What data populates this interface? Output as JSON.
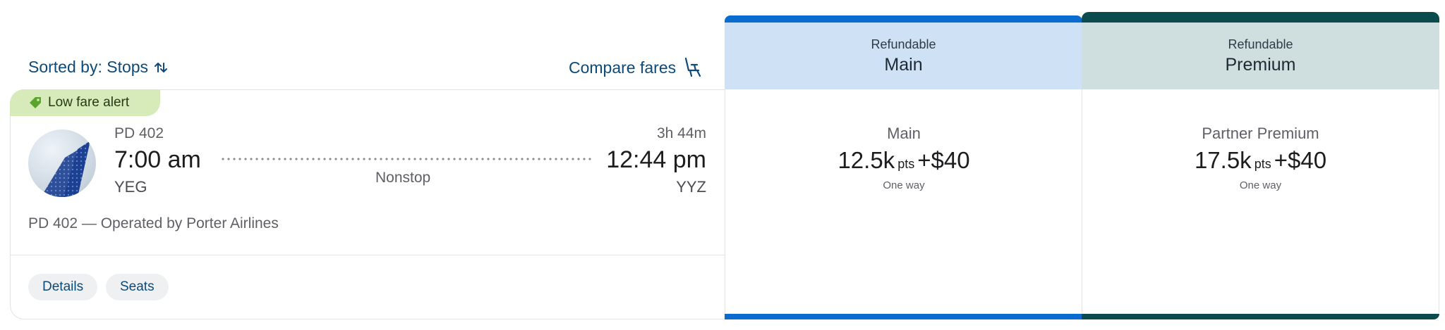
{
  "toolbar": {
    "sort_label": "Sorted by: Stops",
    "sort_icon": "sort-arrows-icon",
    "compare_label": "Compare fares",
    "compare_icon": "seat-icon"
  },
  "flight": {
    "badge": "Low fare alert",
    "badge_icon": "tag-icon",
    "flight_number": "PD 402",
    "depart_time": "7:00 am",
    "depart_airport": "YEG",
    "duration": "3h 44m",
    "arrive_time": "12:44 pm",
    "arrive_airport": "YYZ",
    "stops": "Nonstop",
    "operated_by": "PD 402 — Operated by Porter Airlines",
    "details_label": "Details",
    "seats_label": "Seats"
  },
  "fares": [
    {
      "refundable": "Refundable",
      "cabin": "Main",
      "name": "Main",
      "points": "12.5k",
      "points_unit": "pts",
      "plus": "+",
      "cash": "$40",
      "trip": "One way",
      "header_bg": "#cfe2f5",
      "accent": "#0a6ccf"
    },
    {
      "refundable": "Refundable",
      "cabin": "Premium",
      "name": "Partner Premium",
      "points": "17.5k",
      "points_unit": "pts",
      "plus": "+",
      "cash": "$40",
      "trip": "One way",
      "header_bg": "#cfdfe0",
      "accent": "#0b4b4d"
    }
  ]
}
